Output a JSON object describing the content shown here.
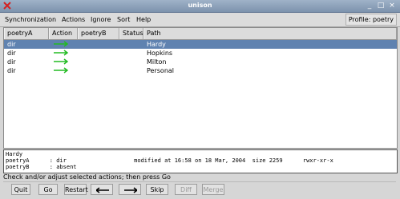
{
  "window": {
    "title": "unison"
  },
  "menu": {
    "items": [
      "Synchronization",
      "Actions",
      "Ignore",
      "Sort",
      "Help"
    ],
    "profile": "Profile: poetry"
  },
  "table": {
    "headers": [
      "poetryA",
      "Action",
      "poetryB",
      "Status",
      "Path"
    ],
    "rows": [
      {
        "a": "dir",
        "action": "right-arrow",
        "b": "",
        "status": "",
        "path": "Hardy",
        "selected": true
      },
      {
        "a": "dir",
        "action": "right-arrow",
        "b": "",
        "status": "",
        "path": "Hopkins",
        "selected": false
      },
      {
        "a": "dir",
        "action": "right-arrow",
        "b": "",
        "status": "",
        "path": "Milton",
        "selected": false
      },
      {
        "a": "dir",
        "action": "right-arrow",
        "b": "",
        "status": "",
        "path": "Personal",
        "selected": false
      }
    ]
  },
  "details": {
    "line1": "Hardy",
    "line2": "poetryA      : dir                    modified at 16:58 on 18 Mar, 2004  size 2259      rwxr-xr-x",
    "line3": "poetryB      : absent"
  },
  "status_text": "Check and/or adjust selected actions; then press Go",
  "buttons": {
    "quit": "Quit",
    "go": "Go",
    "restart": "Restart",
    "skip": "Skip",
    "diff": "Diff",
    "merge": "Merge"
  },
  "colors": {
    "selection": "#5f82b0",
    "arrow": "#22bb22"
  }
}
